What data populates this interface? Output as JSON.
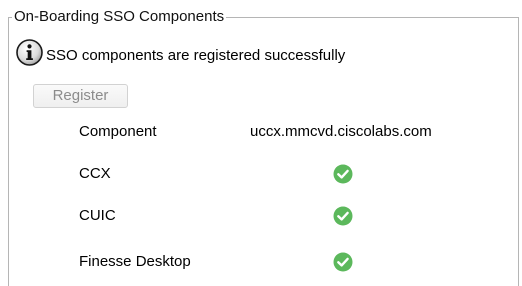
{
  "panel": {
    "legend": "On-Boarding SSO Components"
  },
  "status": {
    "icon": "info-icon",
    "message": "SSO components are registered successfully"
  },
  "register_button": {
    "label": "Register",
    "disabled": true
  },
  "components_table": {
    "header": {
      "component": "Component",
      "host": "uccx.mmcvd.ciscolabs.com"
    },
    "rows": [
      {
        "component": "CCX",
        "status": "registered",
        "icon": "check-circle-icon"
      },
      {
        "component": "CUIC",
        "status": "registered",
        "icon": "check-circle-icon"
      },
      {
        "component": "Finesse Desktop",
        "status": "registered",
        "icon": "check-circle-icon"
      }
    ]
  },
  "colors": {
    "success_green": "#5cb85c",
    "border_gray": "#b5b5b5",
    "disabled_text": "#8c8c8c"
  }
}
